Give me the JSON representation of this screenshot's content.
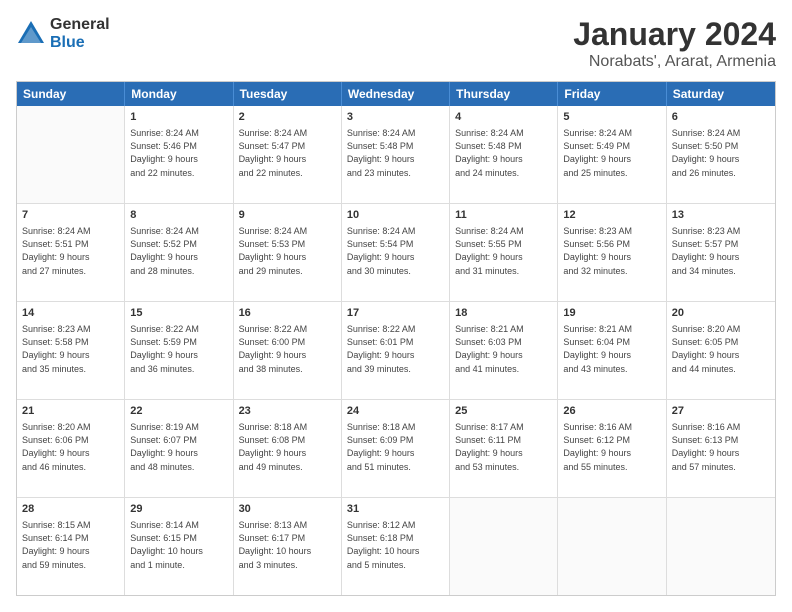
{
  "logo": {
    "general": "General",
    "blue": "Blue"
  },
  "header": {
    "month": "January 2024",
    "location": "Norabats', Ararat, Armenia"
  },
  "days": [
    "Sunday",
    "Monday",
    "Tuesday",
    "Wednesday",
    "Thursday",
    "Friday",
    "Saturday"
  ],
  "weeks": [
    [
      {
        "day": "",
        "info": ""
      },
      {
        "day": "1",
        "info": "Sunrise: 8:24 AM\nSunset: 5:46 PM\nDaylight: 9 hours\nand 22 minutes."
      },
      {
        "day": "2",
        "info": "Sunrise: 8:24 AM\nSunset: 5:47 PM\nDaylight: 9 hours\nand 22 minutes."
      },
      {
        "day": "3",
        "info": "Sunrise: 8:24 AM\nSunset: 5:48 PM\nDaylight: 9 hours\nand 23 minutes."
      },
      {
        "day": "4",
        "info": "Sunrise: 8:24 AM\nSunset: 5:48 PM\nDaylight: 9 hours\nand 24 minutes."
      },
      {
        "day": "5",
        "info": "Sunrise: 8:24 AM\nSunset: 5:49 PM\nDaylight: 9 hours\nand 25 minutes."
      },
      {
        "day": "6",
        "info": "Sunrise: 8:24 AM\nSunset: 5:50 PM\nDaylight: 9 hours\nand 26 minutes."
      }
    ],
    [
      {
        "day": "7",
        "info": "Sunrise: 8:24 AM\nSunset: 5:51 PM\nDaylight: 9 hours\nand 27 minutes."
      },
      {
        "day": "8",
        "info": "Sunrise: 8:24 AM\nSunset: 5:52 PM\nDaylight: 9 hours\nand 28 minutes."
      },
      {
        "day": "9",
        "info": "Sunrise: 8:24 AM\nSunset: 5:53 PM\nDaylight: 9 hours\nand 29 minutes."
      },
      {
        "day": "10",
        "info": "Sunrise: 8:24 AM\nSunset: 5:54 PM\nDaylight: 9 hours\nand 30 minutes."
      },
      {
        "day": "11",
        "info": "Sunrise: 8:24 AM\nSunset: 5:55 PM\nDaylight: 9 hours\nand 31 minutes."
      },
      {
        "day": "12",
        "info": "Sunrise: 8:23 AM\nSunset: 5:56 PM\nDaylight: 9 hours\nand 32 minutes."
      },
      {
        "day": "13",
        "info": "Sunrise: 8:23 AM\nSunset: 5:57 PM\nDaylight: 9 hours\nand 34 minutes."
      }
    ],
    [
      {
        "day": "14",
        "info": "Sunrise: 8:23 AM\nSunset: 5:58 PM\nDaylight: 9 hours\nand 35 minutes."
      },
      {
        "day": "15",
        "info": "Sunrise: 8:22 AM\nSunset: 5:59 PM\nDaylight: 9 hours\nand 36 minutes."
      },
      {
        "day": "16",
        "info": "Sunrise: 8:22 AM\nSunset: 6:00 PM\nDaylight: 9 hours\nand 38 minutes."
      },
      {
        "day": "17",
        "info": "Sunrise: 8:22 AM\nSunset: 6:01 PM\nDaylight: 9 hours\nand 39 minutes."
      },
      {
        "day": "18",
        "info": "Sunrise: 8:21 AM\nSunset: 6:03 PM\nDaylight: 9 hours\nand 41 minutes."
      },
      {
        "day": "19",
        "info": "Sunrise: 8:21 AM\nSunset: 6:04 PM\nDaylight: 9 hours\nand 43 minutes."
      },
      {
        "day": "20",
        "info": "Sunrise: 8:20 AM\nSunset: 6:05 PM\nDaylight: 9 hours\nand 44 minutes."
      }
    ],
    [
      {
        "day": "21",
        "info": "Sunrise: 8:20 AM\nSunset: 6:06 PM\nDaylight: 9 hours\nand 46 minutes."
      },
      {
        "day": "22",
        "info": "Sunrise: 8:19 AM\nSunset: 6:07 PM\nDaylight: 9 hours\nand 48 minutes."
      },
      {
        "day": "23",
        "info": "Sunrise: 8:18 AM\nSunset: 6:08 PM\nDaylight: 9 hours\nand 49 minutes."
      },
      {
        "day": "24",
        "info": "Sunrise: 8:18 AM\nSunset: 6:09 PM\nDaylight: 9 hours\nand 51 minutes."
      },
      {
        "day": "25",
        "info": "Sunrise: 8:17 AM\nSunset: 6:11 PM\nDaylight: 9 hours\nand 53 minutes."
      },
      {
        "day": "26",
        "info": "Sunrise: 8:16 AM\nSunset: 6:12 PM\nDaylight: 9 hours\nand 55 minutes."
      },
      {
        "day": "27",
        "info": "Sunrise: 8:16 AM\nSunset: 6:13 PM\nDaylight: 9 hours\nand 57 minutes."
      }
    ],
    [
      {
        "day": "28",
        "info": "Sunrise: 8:15 AM\nSunset: 6:14 PM\nDaylight: 9 hours\nand 59 minutes."
      },
      {
        "day": "29",
        "info": "Sunrise: 8:14 AM\nSunset: 6:15 PM\nDaylight: 10 hours\nand 1 minute."
      },
      {
        "day": "30",
        "info": "Sunrise: 8:13 AM\nSunset: 6:17 PM\nDaylight: 10 hours\nand 3 minutes."
      },
      {
        "day": "31",
        "info": "Sunrise: 8:12 AM\nSunset: 6:18 PM\nDaylight: 10 hours\nand 5 minutes."
      },
      {
        "day": "",
        "info": ""
      },
      {
        "day": "",
        "info": ""
      },
      {
        "day": "",
        "info": ""
      }
    ]
  ]
}
